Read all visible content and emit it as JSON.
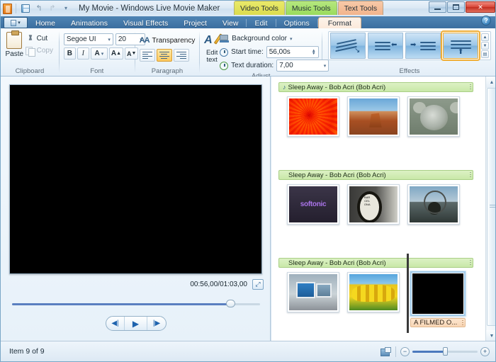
{
  "titlebar": {
    "window_title": "My Movie - Windows Live Movie Maker",
    "app_icon": "movie-maker-icon",
    "quick_access": [
      {
        "name": "save-icon",
        "label": "Save"
      },
      {
        "name": "undo-icon",
        "label": "↰"
      },
      {
        "name": "redo-icon",
        "label": "↱"
      },
      {
        "name": "customize-qat-icon",
        "label": "▾"
      }
    ],
    "window_controls": [
      {
        "name": "minimize-button",
        "label": "—"
      },
      {
        "name": "maximize-button",
        "label": "▢"
      },
      {
        "name": "close-button",
        "label": "✕"
      }
    ],
    "contextual_groups": [
      {
        "label": "Video Tools",
        "color": "#dcdc4e"
      },
      {
        "label": "Music Tools",
        "color": "#9adb5c"
      },
      {
        "label": "Text Tools",
        "color": "#f2b48c"
      }
    ]
  },
  "tabs": {
    "file_tab_label": "",
    "items": [
      {
        "label": "Home",
        "active": false
      },
      {
        "label": "Animations",
        "active": false
      },
      {
        "label": "Visual Effects",
        "active": false
      },
      {
        "label": "Project",
        "active": false
      },
      {
        "label": "View",
        "active": false
      },
      {
        "label": "Edit",
        "active": false
      },
      {
        "label": "Options",
        "active": false
      },
      {
        "label": "Format",
        "active": true
      }
    ],
    "help_label": "?"
  },
  "ribbon": {
    "clipboard": {
      "group_label": "Clipboard",
      "paste_label": "Paste",
      "cut_label": "Cut",
      "copy_label": "Copy"
    },
    "font": {
      "group_label": "Font",
      "font_name": "Segoe UI",
      "font_size": "20",
      "bold_label": "B",
      "italic_label": "I",
      "text_color_label": "A",
      "grow_label": "A",
      "shrink_label": "A"
    },
    "paragraph": {
      "group_label": "Paragraph",
      "transparency_label": "Transparency",
      "align_left_label": "Align left",
      "align_center_label": "Align center",
      "align_right_label": "Align right",
      "selected_alignment": "center"
    },
    "adjust": {
      "group_label": "Adjust",
      "edit_text_label_line1": "Edit",
      "edit_text_label_line2": "text",
      "background_color_label": "Background color",
      "start_time_label": "Start time:",
      "start_time_value": "56,00s",
      "text_duration_label": "Text duration:",
      "text_duration_value": "7,00"
    },
    "effects": {
      "group_label": "Effects",
      "items": [
        {
          "name": "effect-sweep",
          "selected": false
        },
        {
          "name": "effect-fly-in-left",
          "selected": false
        },
        {
          "name": "effect-fly-in-right",
          "selected": false
        },
        {
          "name": "effect-rise-up",
          "selected": true
        }
      ],
      "scroll_up_label": "▲",
      "scroll_down_label": "▼",
      "more_label": "▤"
    }
  },
  "preview": {
    "timecode": "00:56,00/01:03,00",
    "fullscreen_label": "⤢",
    "seek_percent": 88,
    "transport": [
      {
        "name": "previous-frame-button",
        "label": "◀|"
      },
      {
        "name": "play-button",
        "label": "▶"
      },
      {
        "name": "next-frame-button",
        "label": "|▶"
      }
    ]
  },
  "storyboard": {
    "music_track_label": "Sleep Away - Bob Acri (Bob Acri)",
    "rows": [
      {
        "music_label": "Sleep Away - Bob Acri (Bob Acri)",
        "has_note_icon": true,
        "clips": [
          {
            "name": "clip-chrysanthemum",
            "art": "t-flower",
            "selected": false,
            "caption": ""
          },
          {
            "name": "clip-desert",
            "art": "t-desert",
            "selected": false,
            "caption": ""
          },
          {
            "name": "clip-koala",
            "art": "t-koala",
            "selected": false,
            "caption": ""
          }
        ]
      },
      {
        "music_label": "Sleep Away - Bob Acri (Bob Acri)",
        "has_note_icon": false,
        "clips": [
          {
            "name": "clip-softonic",
            "art": "t-softonic",
            "selected": false,
            "caption": ""
          },
          {
            "name": "clip-barcelona",
            "art": "t-barcelona",
            "selected": false,
            "caption": ""
          },
          {
            "name": "clip-window",
            "art": "t-window",
            "selected": false,
            "caption": ""
          }
        ]
      },
      {
        "music_label": "Sleep Away - Bob Acri (Bob Acri)",
        "has_note_icon": false,
        "clips": [
          {
            "name": "clip-office",
            "art": "t-office",
            "selected": false,
            "caption": ""
          },
          {
            "name": "clip-tulips",
            "art": "t-tulip",
            "selected": false,
            "caption": ""
          },
          {
            "name": "clip-title-card",
            "art": "t-black",
            "selected": true,
            "caption": "A FILMED O..."
          }
        ]
      }
    ],
    "softonic_text": "softonic",
    "barcelona_text": "BAR CEL ONA",
    "scrollbar": {
      "up_label": "▲",
      "down_label": "▼"
    }
  },
  "status": {
    "item_count": "Item 9 of 9",
    "thumbnail_size_icon": "thumbnail-size-icon",
    "zoom_out_label": "−",
    "zoom_in_label": "+",
    "zoom_percent": 50
  }
}
